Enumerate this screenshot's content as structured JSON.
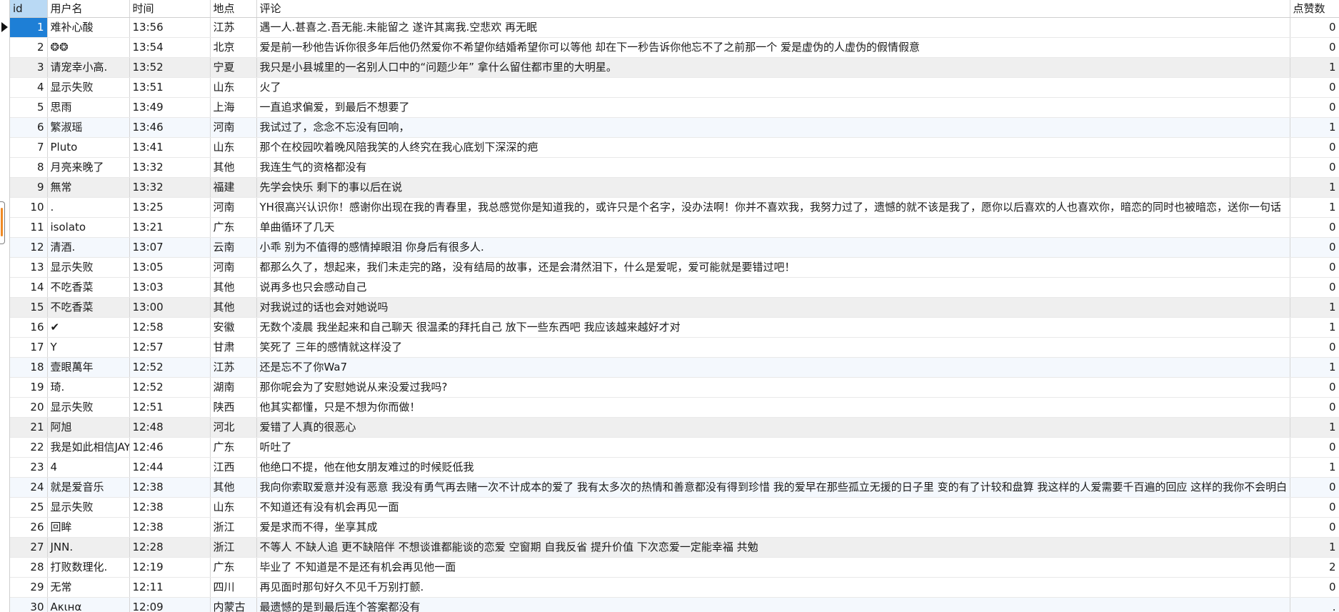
{
  "table": {
    "columns": {
      "id": "id",
      "user": "用户名",
      "time": "时间",
      "location": "地点",
      "comment": "评论",
      "likes": "点赞数"
    },
    "rows": [
      {
        "id": "1",
        "user": "难补心酸",
        "time": "13:56",
        "location": "江苏",
        "comment": "遇一人.甚喜之.吾无能.未能留之 遂许其离我.空悲欢 再无眠",
        "likes": "0"
      },
      {
        "id": "2",
        "user": "❂❂",
        "time": "13:54",
        "location": "北京",
        "comment": "爱是前一秒他告诉你很多年后他仍然爱你不希望你结婚希望你可以等他 却在下一秒告诉你他忘不了之前那一个 爱是虚伪的人虚伪的假情假意",
        "likes": "0"
      },
      {
        "id": "3",
        "user": "请宠幸小高.",
        "time": "13:52",
        "location": "宁夏",
        "comment": "我只是小县城里的一名别人口中的“问题少年” 拿什么留住都市里的大明星。",
        "likes": "1"
      },
      {
        "id": "4",
        "user": "显示失败",
        "time": "13:51",
        "location": "山东",
        "comment": "火了",
        "likes": "0"
      },
      {
        "id": "5",
        "user": "思雨",
        "time": "13:49",
        "location": "上海",
        "comment": "一直追求偏爱，到最后不想要了",
        "likes": "0"
      },
      {
        "id": "6",
        "user": "繁淑瑶",
        "time": "13:46",
        "location": "河南",
        "comment": "我试过了，念念不忘没有回响，",
        "likes": "1"
      },
      {
        "id": "7",
        "user": "Pluto",
        "time": "13:41",
        "location": "山东",
        "comment": "那个在校园吹着晚风陪我笑的人终究在我心底划下深深的疤",
        "likes": "0"
      },
      {
        "id": "8",
        "user": "月亮来晚了",
        "time": "13:32",
        "location": "其他",
        "comment": "我连生气的资格都没有",
        "likes": "0"
      },
      {
        "id": "9",
        "user": "無常",
        "time": "13:32",
        "location": "福建",
        "comment": "先学会快乐 剩下的事以后在说",
        "likes": "1"
      },
      {
        "id": "10",
        "user": ".",
        "time": "13:25",
        "location": "河南",
        "comment": "YH很高兴认识你！感谢你出现在我的青春里，我总感觉你是知道我的，或许只是个名字，没办法啊！你并不喜欢我，我努力过了，遗憾的就不该是我了，愿你以后喜欢的人也喜欢你，暗恋的同时也被暗恋，送你一句话",
        "likes": "1"
      },
      {
        "id": "11",
        "user": "isolato",
        "time": "13:21",
        "location": "广东",
        "comment": "单曲循环了几天",
        "likes": "0"
      },
      {
        "id": "12",
        "user": "清酒.",
        "time": "13:07",
        "location": "云南",
        "comment": "小乖  别为不值得的感情掉眼泪  你身后有很多人.",
        "likes": "0"
      },
      {
        "id": "13",
        "user": "显示失败",
        "time": "13:05",
        "location": "河南",
        "comment": "都那么久了，想起来，我们未走完的路，没有结局的故事，还是会潸然泪下，什么是爱呢，爱可能就是要错过吧！",
        "likes": "0"
      },
      {
        "id": "14",
        "user": "不吃香菜",
        "time": "13:03",
        "location": "其他",
        "comment": "说再多也只会感动自己",
        "likes": "0"
      },
      {
        "id": "15",
        "user": "不吃香菜",
        "time": "13:00",
        "location": "其他",
        "comment": "对我说过的话也会对她说吗",
        "likes": "1"
      },
      {
        "id": "16",
        "user": "✔",
        "time": "12:58",
        "location": "安徽",
        "comment": "无数个凌晨 我坐起来和自己聊天 很温柔的拜托自己 放下一些东西吧 我应该越来越好才对",
        "likes": "1"
      },
      {
        "id": "17",
        "user": "Y",
        "time": "12:57",
        "location": "甘肃",
        "comment": "笑死了 三年的感情就这样没了",
        "likes": "0"
      },
      {
        "id": "18",
        "user": "壹眼萬年",
        "time": "12:52",
        "location": "江苏",
        "comment": "还是忘不了你Wa7",
        "likes": "1"
      },
      {
        "id": "19",
        "user": "琦.",
        "time": "12:52",
        "location": "湖南",
        "comment": "那你呢会为了安慰她说从来没爱过我吗?",
        "likes": "0"
      },
      {
        "id": "20",
        "user": "显示失败",
        "time": "12:51",
        "location": "陕西",
        "comment": "他其实都懂，只是不想为你而做！",
        "likes": "0"
      },
      {
        "id": "21",
        "user": "阿旭",
        "time": "12:48",
        "location": "河北",
        "comment": "爱错了人真的很恶心",
        "likes": "1"
      },
      {
        "id": "22",
        "user": "我是如此相信JAY",
        "time": "12:46",
        "location": "广东",
        "comment": "听吐了",
        "likes": "0"
      },
      {
        "id": "23",
        "user": "4",
        "time": "12:44",
        "location": "江西",
        "comment": "他绝口不提，他在他女朋友难过的时候贬低我",
        "likes": "1"
      },
      {
        "id": "24",
        "user": "就是爱音乐",
        "time": "12:38",
        "location": "其他",
        "comment": "我向你索取爱意并没有恶意 我没有勇气再去赌一次不计成本的爱了 我有太多次的热情和善意都没有得到珍惜 我的爱早在那些孤立无援的日子里 变的有了计较和盘算 我这样的人爱需要千百遍的回应 这样的我你不会明白",
        "likes": "0"
      },
      {
        "id": "25",
        "user": "显示失败",
        "time": "12:38",
        "location": "山东",
        "comment": "不知道还有没有机会再见一面",
        "likes": "0"
      },
      {
        "id": "26",
        "user": "回眸",
        "time": "12:38",
        "location": "浙江",
        "comment": "爱是求而不得，坐享其成",
        "likes": "0"
      },
      {
        "id": "27",
        "user": "JNN.",
        "time": "12:28",
        "location": "浙江",
        "comment": "不等人 不缺人追 更不缺陪伴 不想谈谁都能谈的恋爱 空窗期 自我反省 提升价值 下次恋爱一定能幸福 共勉",
        "likes": "1"
      },
      {
        "id": "28",
        "user": "打败数理化.",
        "time": "12:19",
        "location": "广东",
        "comment": "毕业了 不知道是不是还有机会再见他一面",
        "likes": "2"
      },
      {
        "id": "29",
        "user": "无常",
        "time": "12:11",
        "location": "四川",
        "comment": "再见面时那句好久不见千万别打颤.",
        "likes": "0"
      },
      {
        "id": "30",
        "user": "Aκιнα",
        "time": "12:09",
        "location": "内蒙古",
        "comment": "最遗憾的是到最后连个答案都没有",
        "likes": "."
      }
    ]
  }
}
